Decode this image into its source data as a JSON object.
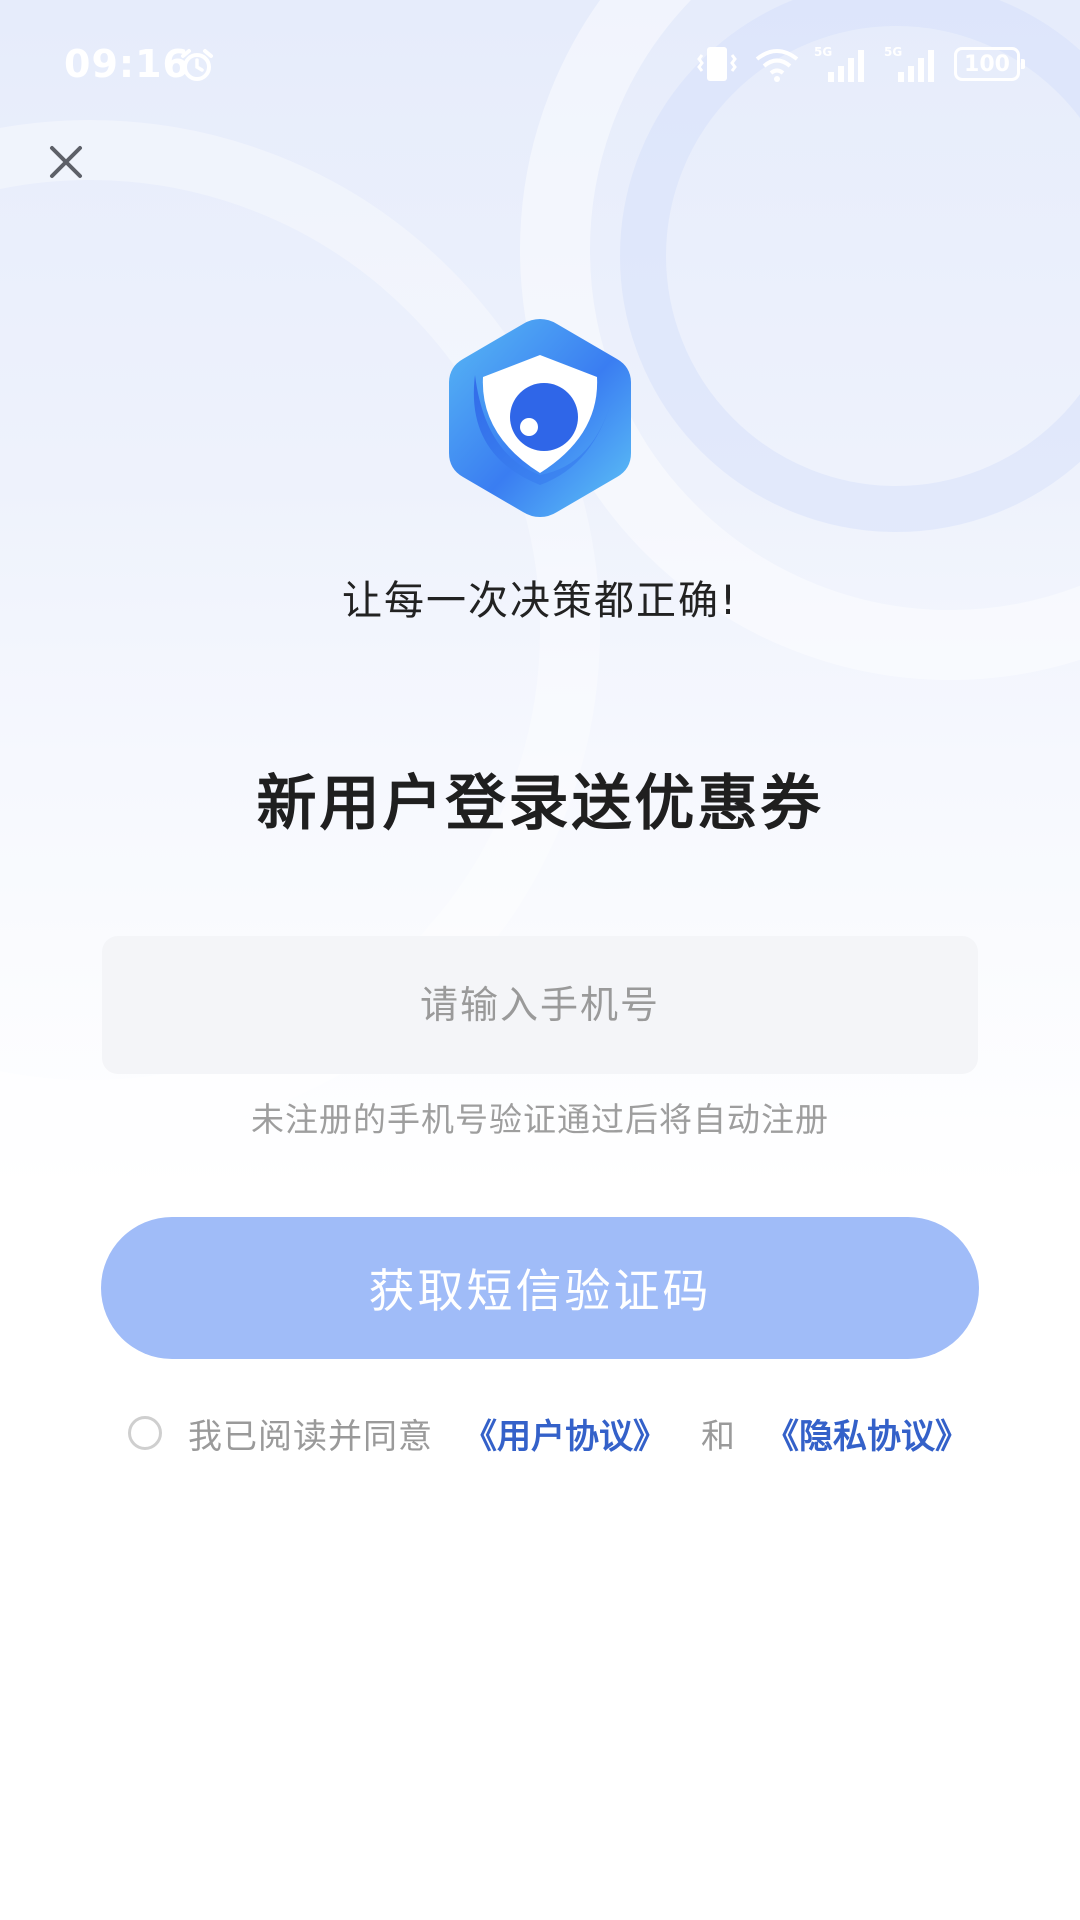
{
  "status_bar": {
    "time": "09:16",
    "battery": "100"
  },
  "icons": {
    "close": "close-icon",
    "alarm": "alarm-icon",
    "vibrate": "vibrate-icon",
    "wifi": "wifi-icon",
    "signal": "signal-icon",
    "logo": "eye-shield-logo"
  },
  "slogan": "让每一次决策都正确!",
  "headline": "新用户登录送优惠券",
  "phone_input": {
    "value": "",
    "placeholder": "请输入手机号"
  },
  "hint": "未注册的手机号验证通过后将自动注册",
  "sms_button_label": "获取短信验证码",
  "agreement": {
    "prefix": "我已阅读并同意",
    "user_agreement": "《用户协议》",
    "and": "和",
    "privacy_agreement": "《隐私协议》"
  },
  "colors": {
    "primary": "#3461c9",
    "button_disabled": "#a0bcf8",
    "input_bg": "#f4f5f8",
    "logo_blue": "#3a7df2",
    "logo_light_blue": "#58b9f4"
  }
}
